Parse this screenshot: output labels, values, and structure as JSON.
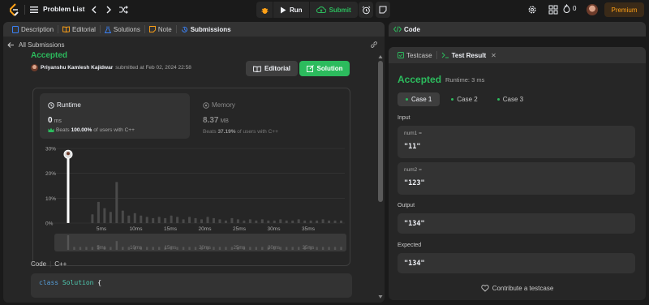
{
  "topnav": {
    "problem_list": "Problem List",
    "run": "Run",
    "submit": "Submit",
    "streak": "0",
    "premium": "Premium"
  },
  "left_tabs": [
    {
      "label": "Description",
      "icon": "description-icon"
    },
    {
      "label": "Editorial",
      "icon": "book-icon"
    },
    {
      "label": "Solutions",
      "icon": "flask-icon"
    },
    {
      "label": "Note",
      "icon": "note-icon"
    },
    {
      "label": "Submissions",
      "icon": "history-icon"
    }
  ],
  "submission": {
    "back_label": "All Submissions",
    "status": "Accepted",
    "author": "Priyanshu Kamlesh Kajidwar",
    "submitted_text": "submitted at Feb 02, 2024 22:58",
    "editorial_btn": "Editorial",
    "solution_btn": "Solution",
    "runtime": {
      "label": "Runtime",
      "value": "0",
      "unit": "ms",
      "beats_prefix": "Beats",
      "beats_value": "100.00%",
      "beats_suffix": "of users with C++"
    },
    "memory": {
      "label": "Memory",
      "value": "8.37",
      "unit": "MB",
      "beats_prefix": "Beats",
      "beats_value": "37.19%",
      "beats_suffix": "of users with C++"
    },
    "code_language_label": "Code",
    "code_language": "C++",
    "code_line_kw": "class",
    "code_line_cls": "Solution",
    "code_line_rest": " {"
  },
  "chart_data": {
    "type": "bar",
    "y_ticks": [
      "30%",
      "20%",
      "10%",
      "0%"
    ],
    "x_ticks": [
      "5ms",
      "10ms",
      "15ms",
      "20ms",
      "25ms",
      "30ms",
      "35ms"
    ],
    "ylim": [
      0,
      30
    ],
    "values": [
      27,
      0,
      0,
      0,
      3.5,
      8.5,
      6,
      4.5,
      16.5,
      5,
      3,
      4,
      3,
      2.5,
      2,
      2.5,
      2,
      3,
      2.5,
      1.5,
      2.5,
      2,
      1.5,
      2.5,
      2,
      1.5,
      1,
      2,
      1.5,
      1,
      1.5,
      1,
      1.5,
      1,
      1,
      1.5,
      1,
      1,
      1.5,
      1,
      1,
      1,
      1.5,
      1,
      1,
      1
    ],
    "highlight_index": 0,
    "highlight_color": "#ffffff",
    "bar_color": "#4a4a4a",
    "mini_values": [
      5,
      1,
      1,
      1,
      1,
      1.5,
      1,
      1,
      3,
      1,
      1,
      1,
      1,
      1,
      1,
      1,
      1,
      1,
      1,
      1,
      1,
      1,
      1,
      1,
      1,
      1,
      1,
      1,
      1,
      1,
      1,
      1,
      1,
      1,
      1,
      1,
      1,
      1,
      1,
      1,
      1,
      1,
      1,
      1,
      1,
      1
    ]
  },
  "right": {
    "code_tab": "Code",
    "testcase_tab": "Testcase",
    "test_result_tab": "Test Result",
    "result_title": "Accepted",
    "runtime_text": "Runtime: 3 ms",
    "cases": [
      "Case 1",
      "Case 2",
      "Case 3"
    ],
    "input_label": "Input",
    "inputs": [
      {
        "name": "num1 =",
        "value": "\"11\""
      },
      {
        "name": "num2 =",
        "value": "\"123\""
      }
    ],
    "output_label": "Output",
    "output_value": "\"134\"",
    "expected_label": "Expected",
    "expected_value": "\"134\"",
    "contribute": "Contribute a testcase"
  },
  "colors": {
    "accent_green": "#2cbb5d",
    "premium_orange": "#ffa116"
  }
}
